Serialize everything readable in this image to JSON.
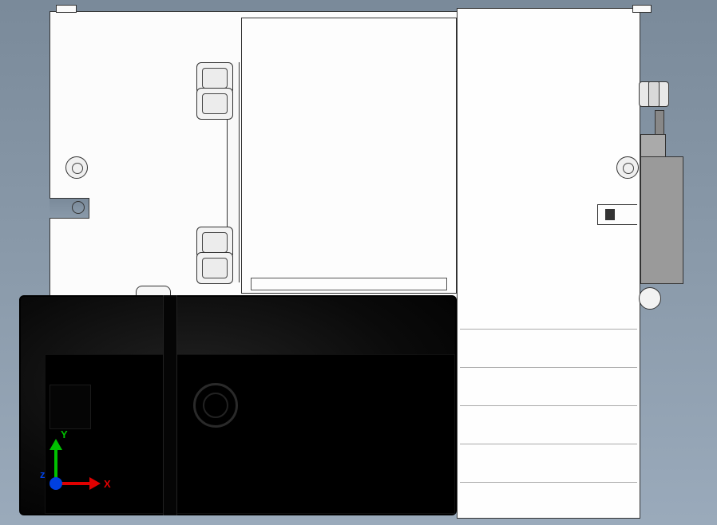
{
  "cad_view": {
    "triad": {
      "axis_x": "X",
      "axis_y": "Y",
      "axis_z": "z"
    }
  }
}
